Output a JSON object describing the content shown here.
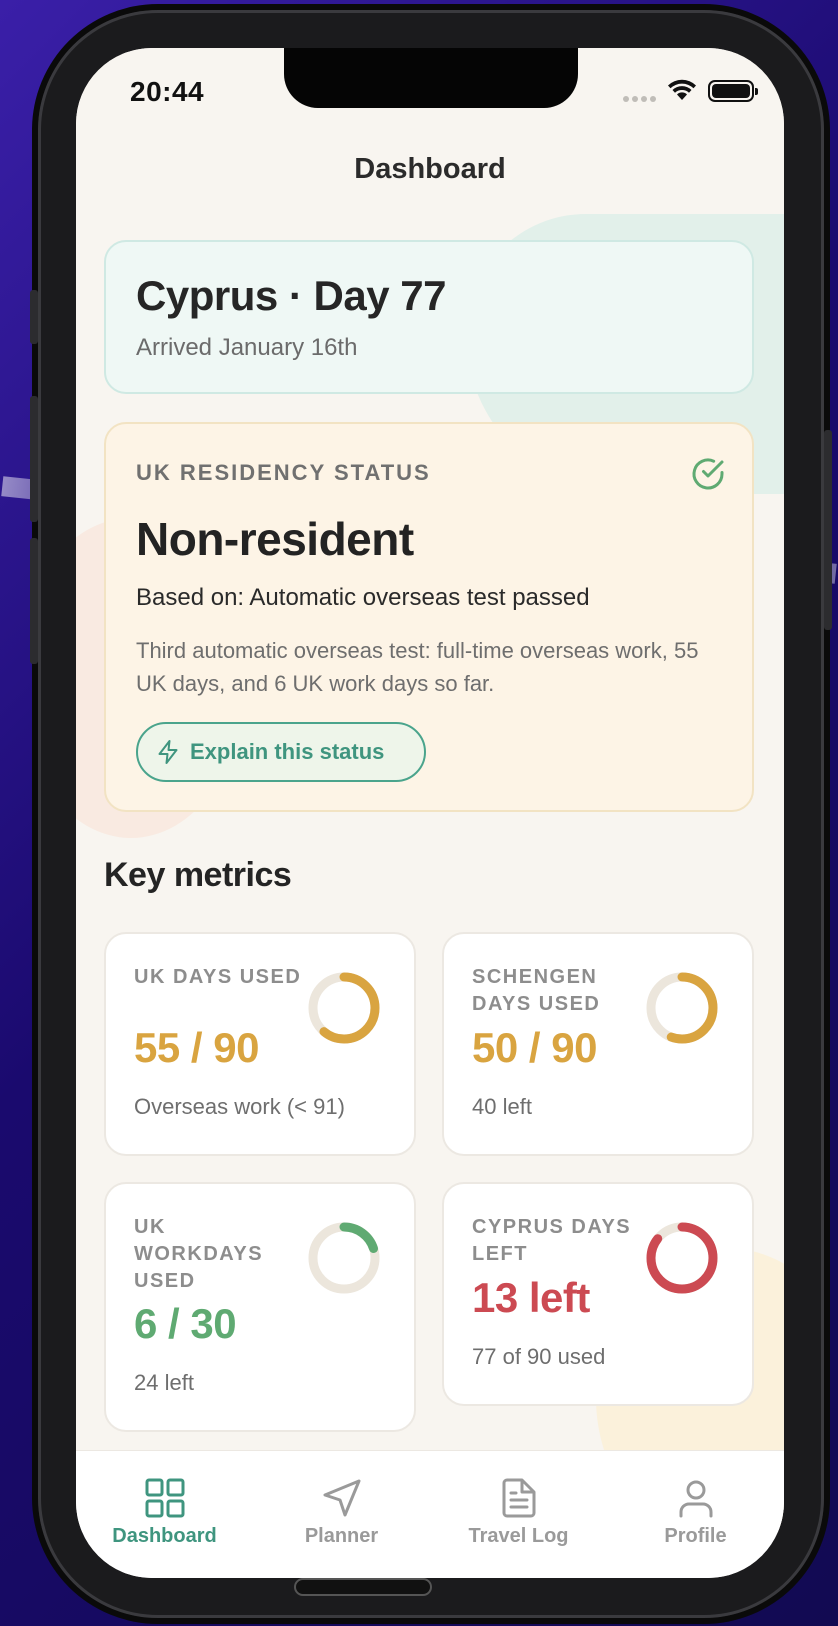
{
  "status_bar": {
    "time": "20:44"
  },
  "nav": {
    "title": "Dashboard"
  },
  "location": {
    "title": "Cyprus · Day 77",
    "subtitle": "Arrived January 16th"
  },
  "residency": {
    "label": "UK RESIDENCY STATUS",
    "status": "Non-resident",
    "based_on": "Based on: Automatic overseas test passed",
    "description": "Third automatic overseas test: full-time overseas work, 55 UK days, and 6 UK work days so far.",
    "explain_button": "Explain this status"
  },
  "metrics_title": "Key metrics",
  "metrics": [
    {
      "label": "UK DAYS USED",
      "value": "55 / 90",
      "footer": "Overseas work (< 91)",
      "used": 55,
      "total": 90,
      "color": "#d9a440"
    },
    {
      "label": "SCHENGEN DAYS USED",
      "value": "50 / 90",
      "footer": "40 left",
      "used": 50,
      "total": 90,
      "color": "#d9a440"
    },
    {
      "label": "UK WORKDAYS USED",
      "value": "6 / 30",
      "footer": "24 left",
      "used": 6,
      "total": 30,
      "color": "#5faa72"
    },
    {
      "label": "CYPRUS DAYS LEFT",
      "value": "13 left",
      "footer": "77 of 90 used",
      "used": 77,
      "total": 90,
      "color": "#cc4a52"
    }
  ],
  "tabs": [
    {
      "label": "Dashboard",
      "icon": "grid-icon",
      "active": true
    },
    {
      "label": "Planner",
      "icon": "navigation-arrow-icon",
      "active": false
    },
    {
      "label": "Travel Log",
      "icon": "document-icon",
      "active": false
    },
    {
      "label": "Profile",
      "icon": "person-icon",
      "active": false
    }
  ],
  "colors": {
    "accent": "#3f957f",
    "amber": "#d9a440",
    "green": "#5faa72",
    "red": "#cc4a52"
  }
}
